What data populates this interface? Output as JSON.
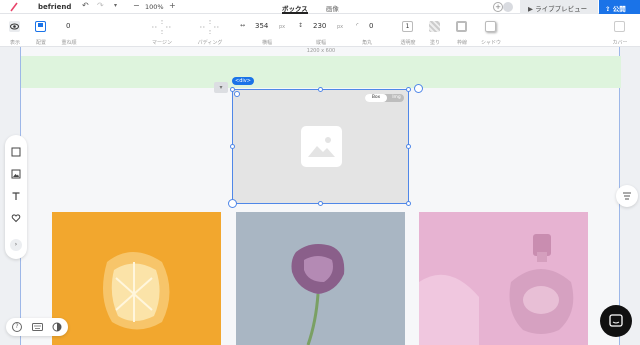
{
  "app": {
    "site_name": "befriend",
    "zoom": "100%"
  },
  "tabs": [
    {
      "label": "ボックス",
      "active": true
    },
    {
      "label": "画像",
      "active": false
    }
  ],
  "actions": {
    "live_preview": "ライブプレビュー",
    "publish": "公開"
  },
  "props": {
    "display_label": "表示",
    "layout_label": "配置",
    "order_value": "0",
    "order_label": "重ね順",
    "margin_label": "マージン",
    "padding_label": "パディング",
    "width_value": "354",
    "width_unit": "px",
    "width_label": "横幅",
    "height_value": "230",
    "height_unit": "px",
    "height_label": "縦幅",
    "radius_value": "0",
    "radius_label": "角丸",
    "opacity_value": "1",
    "opacity_label": "透明度",
    "fill_label": "塗り",
    "border_label": "枠線",
    "shadow_label": "シャドウ",
    "cover_label": "カバー"
  },
  "canvas": {
    "ruler_label": "1200 x 600",
    "div_tag": "<div>",
    "toggle_on": "Box",
    "toggle_off": "Img"
  },
  "colors": {
    "accent": "#1a73e8",
    "green_band": "#def4dd",
    "selection": "#4f87e8"
  }
}
